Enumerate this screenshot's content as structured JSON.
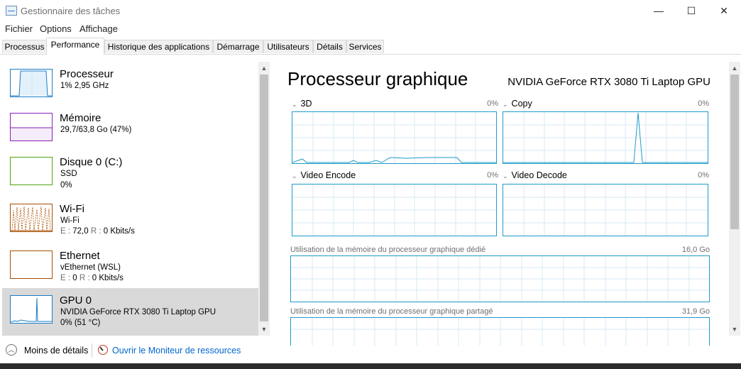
{
  "window": {
    "title": "Gestionnaire des tâches",
    "minimize": "—",
    "maximize": "☐",
    "close": "✕"
  },
  "menu": [
    "Fichier",
    "Options",
    "Affichage"
  ],
  "tabs": [
    "Processus",
    "Performance",
    "Historique des applications",
    "Démarrage",
    "Utilisateurs",
    "Détails",
    "Services"
  ],
  "active_tab": "Performance",
  "sidebar": {
    "items": [
      {
        "name": "Processeur",
        "line1": "1%  2,95 GHz",
        "line2": "",
        "color": "#1c7dc5",
        "selected": false
      },
      {
        "name": "Mémoire",
        "line1": "29,7/63,8 Go (47%)",
        "line2": "",
        "color": "#8b1ebb",
        "selected": false
      },
      {
        "name": "Disque 0 (C:)",
        "line1": "SSD",
        "line2": "0%",
        "color": "#4da60c",
        "selected": false
      },
      {
        "name": "Wi-Fi",
        "line1": "Wi-Fi",
        "line2_lbl_e": "E :",
        "line2_val_e": "72,0",
        "line2_lbl_r": "R :",
        "line2_val_r": "0 Kbits/s",
        "color": "#a74f01",
        "selected": false
      },
      {
        "name": "Ethernet",
        "line1": "vEthernet (WSL)",
        "line2_lbl_e": "E :",
        "line2_val_e": "0",
        "line2_lbl_r": "R :",
        "line2_val_r": "0 Kbits/s",
        "color": "#a74f01",
        "selected": false
      },
      {
        "name": "GPU 0",
        "line1": "NVIDIA GeForce RTX 3080 Ti Laptop GPU",
        "line2": "0%  (51 °C)",
        "color": "#1c7dc5",
        "selected": true
      }
    ]
  },
  "main": {
    "title": "Processeur graphique",
    "gpu_name": "NVIDIA GeForce RTX 3080 Ti Laptop GPU",
    "engines": [
      {
        "label": "3D",
        "pct": "0%"
      },
      {
        "label": "Copy",
        "pct": "0%"
      },
      {
        "label": "Video Encode",
        "pct": "0%"
      },
      {
        "label": "Video Decode",
        "pct": "0%"
      }
    ],
    "dedicated_label": "Utilisation de la mémoire du processeur graphique dédié",
    "dedicated_value": "16,0 Go",
    "shared_label": "Utilisation de la mémoire du processeur graphique partagé",
    "shared_value": "31,9 Go"
  },
  "footer": {
    "less_details": "Moins de détails",
    "monitor_link": "Ouvrir le Moniteur de ressources"
  },
  "colors": {
    "graph_border": "#1f9ac9",
    "grid": "#d6eaf4",
    "line": "#1f9ac9"
  }
}
